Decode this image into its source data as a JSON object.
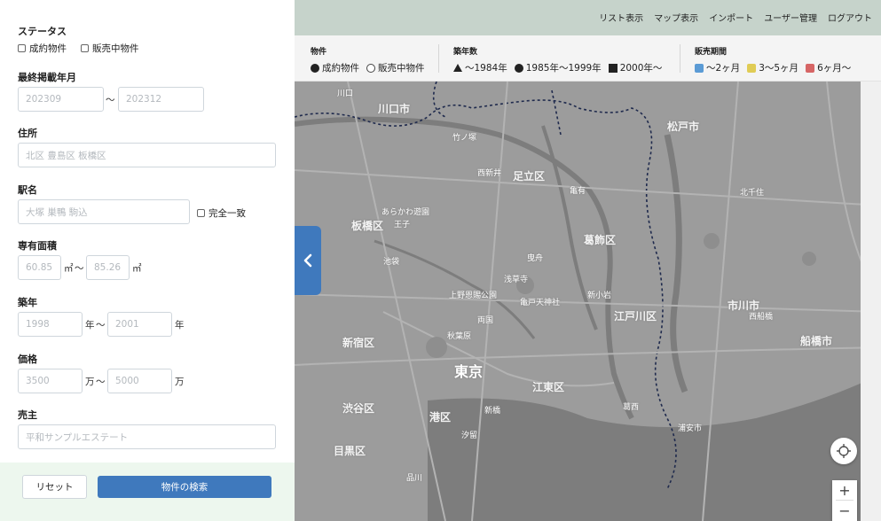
{
  "nav": {
    "items": [
      "リスト表示",
      "マップ表示",
      "インポート",
      "ユーザー管理",
      "ログアウト"
    ]
  },
  "legend": {
    "property": {
      "title": "物件",
      "items": [
        "成約物件",
        "販売中物件"
      ]
    },
    "age": {
      "title": "築年数",
      "items": [
        "〜1984年",
        "1985年〜1999年",
        "2000年〜"
      ]
    },
    "period": {
      "title": "販売期間",
      "items": [
        {
          "label": "〜2ヶ月",
          "color": "#5b9bd5"
        },
        {
          "label": "3〜5ヶ月",
          "color": "#e0cc55"
        },
        {
          "label": "6ヶ月〜",
          "color": "#d66565"
        }
      ]
    }
  },
  "filters": {
    "status": {
      "title": "ステータス",
      "options": [
        "成約物件",
        "販売中物件"
      ]
    },
    "listing": {
      "title": "最終掲載年月",
      "from": "202309",
      "to": "202312",
      "sep": "〜"
    },
    "address": {
      "title": "住所",
      "placeholder": "北区 豊島区 板橋区"
    },
    "station": {
      "title": "駅名",
      "placeholder": "大塚 巣鴨 駒込",
      "exact_label": "完全一致"
    },
    "area": {
      "title": "専有面積",
      "from": "60.85",
      "to": "85.26",
      "unit": "㎡",
      "sep": "〜"
    },
    "built": {
      "title": "築年",
      "from": "1998",
      "to": "2001",
      "unit": "年",
      "sep": "〜"
    },
    "price": {
      "title": "価格",
      "from": "3500",
      "to": "5000",
      "unit": "万",
      "sep": "〜"
    },
    "seller": {
      "title": "売主",
      "placeholder": "平和サンプルエステート"
    }
  },
  "actions": {
    "reset": "リセット",
    "search": "物件の検索"
  },
  "map": {
    "collapse_icon": "chevron-left-icon",
    "zoom_in": "+",
    "zoom_out": "−",
    "labels": {
      "kawaguchi": "川口市",
      "kawaguchi_sta": "川口",
      "adachi": "足立区",
      "itabashi": "板橋区",
      "katsushika": "葛飾区",
      "edogawa": "江戸川区",
      "koto": "江東区",
      "minato": "港区",
      "shibuya": "渋谷区",
      "meguro": "目黒区",
      "shinjuku": "新宿区",
      "tokyo": "東京",
      "ichikawa": "市川市",
      "funabashi": "船橋市",
      "matsudo": "松戸市",
      "ikebukuro": "池袋",
      "akihabara": "秋葉原",
      "kameari": "亀有",
      "shinagawa": "品川",
      "kitasenju": "北千住",
      "urayasu": "浦安市",
      "kasai": "葛西",
      "nishiarai": "西新井",
      "oji": "王子",
      "takenotsuka": "竹ノ塚",
      "kameido": "亀戸天神社",
      "ueno": "上野恩賜公園",
      "hikifune": "曳舟",
      "arakawa": "あらかわ遊園",
      "nishifunabashi": "西船橋",
      "minamikoiwa": "新小岩",
      "ryogoku": "両国",
      "shiohama": "汐留",
      "asakusa": "浅草寺",
      "shimbashi": "新橋"
    }
  }
}
